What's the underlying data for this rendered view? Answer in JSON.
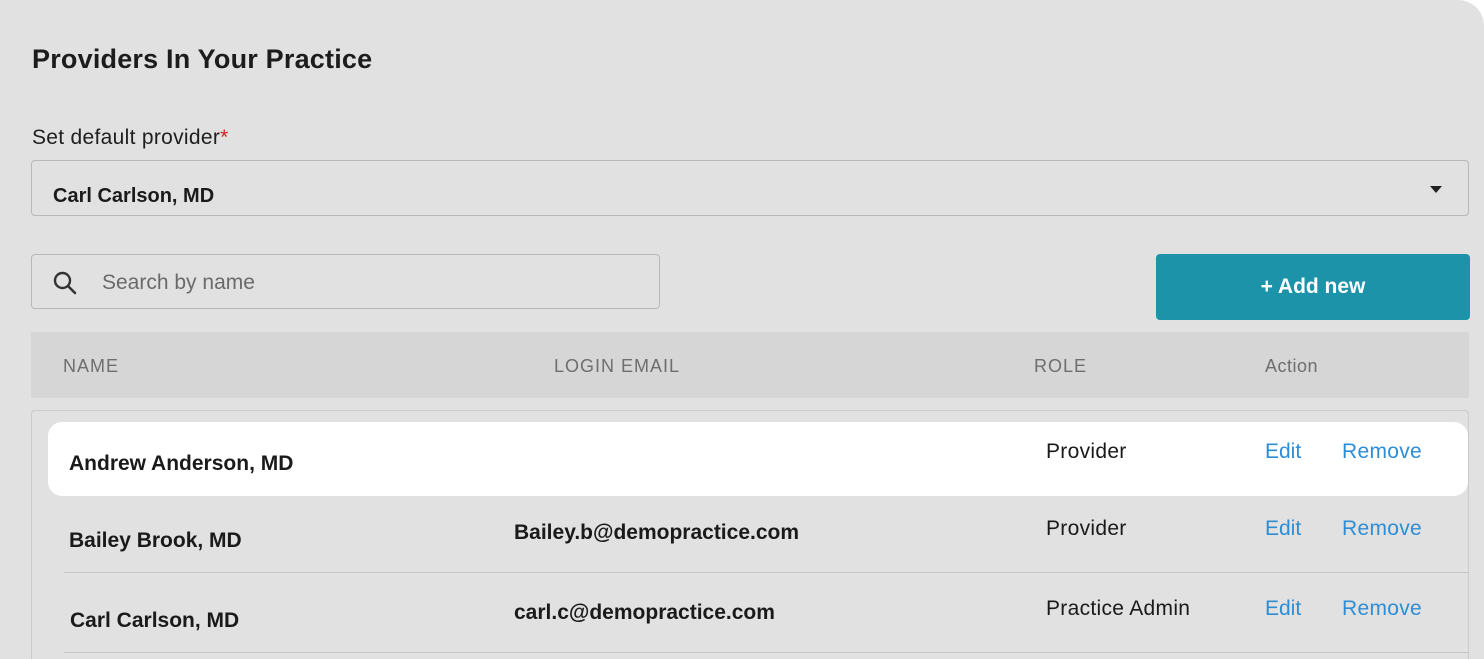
{
  "page": {
    "title": "Providers In Your Practice"
  },
  "default_provider": {
    "label": "Set default provider",
    "required_mark": "*",
    "selected": "Carl Carlson, MD"
  },
  "search": {
    "placeholder": "Search by name",
    "value": ""
  },
  "add_button": {
    "label": "+ Add new"
  },
  "table": {
    "columns": [
      "NAME",
      "LOGIN EMAIL",
      "ROLE",
      "Action"
    ],
    "rows": [
      {
        "name": "Andrew Anderson, MD",
        "email": "",
        "role": "Provider",
        "edit": "Edit",
        "remove": "Remove"
      },
      {
        "name": "Bailey Brook, MD",
        "email": "Bailey.b@demopractice.com",
        "role": "Provider",
        "edit": "Edit",
        "remove": "Remove"
      },
      {
        "name": "Carl Carlson, MD",
        "email": "carl.c@demopractice.com",
        "role": "Practice Admin",
        "edit": "Edit",
        "remove": "Remove"
      }
    ]
  },
  "colors": {
    "panel_bg": "#e1e1e1",
    "accent_button": "#1c93a8",
    "link": "#2d8ed6",
    "required": "#d32020",
    "highlight_row": "#ffffff"
  },
  "icons": {
    "search": "search-icon",
    "dropdown": "caret-down-icon"
  }
}
